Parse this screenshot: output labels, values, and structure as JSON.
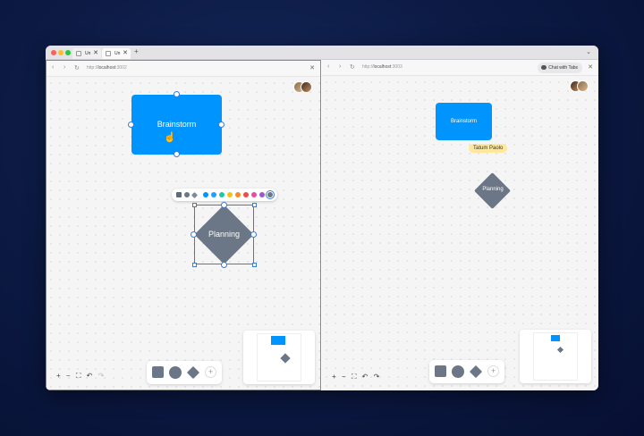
{
  "browser": {
    "tabs": [
      {
        "label": "Un"
      },
      {
        "label": "Un"
      }
    ],
    "new_tab_symbol": "+",
    "menu_symbol": "⌄"
  },
  "left_pane": {
    "url_prefix": "http://",
    "url_host": "localhost",
    "url_port": ":3002",
    "shapes": {
      "rect_label": "Brainstorm",
      "diamond_label": "Planning"
    },
    "palette_colors": [
      "#5f6b7a",
      "#6b7686",
      "#7f8a98",
      "#0094ff",
      "#1fa0ff",
      "#25c2b0",
      "#f2c21b",
      "#f58a26",
      "#ef4b4b",
      "#e94ba4",
      "#9b59d0",
      "#6b7686"
    ],
    "zoom_controls": [
      "+",
      "−",
      "⛶",
      "↶",
      "↷"
    ]
  },
  "right_pane": {
    "url_prefix": "http://",
    "url_host": "localhost",
    "url_port": ":3003",
    "chat_button": "Chat with Tabs",
    "shapes": {
      "rect_label": "Brainstorm",
      "diamond_label": "Planning"
    },
    "cursor_tooltip": "Tatum Paolo",
    "zoom_controls": [
      "+",
      "−",
      "⛶",
      "↶",
      "↷"
    ]
  },
  "icons": {
    "back": "‹",
    "forward": "›",
    "reload": "↻",
    "close": "✕",
    "add": "+",
    "cursor": "☝"
  },
  "colors": {
    "accent": "#0094ff",
    "shape_gray": "#6b7686",
    "selection": "#3a7bd5",
    "tooltip": "#ffe89a"
  }
}
